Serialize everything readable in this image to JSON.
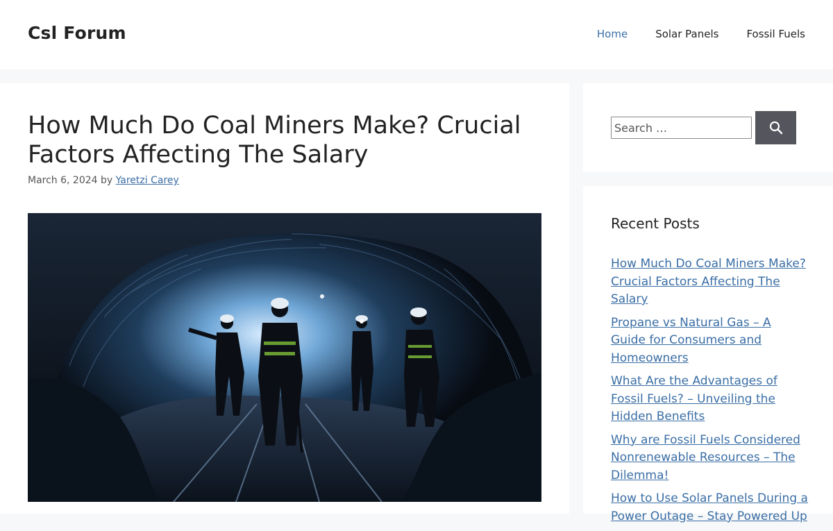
{
  "header": {
    "site_title": "Csl Forum",
    "nav": [
      {
        "label": "Home",
        "active": true
      },
      {
        "label": "Solar Panels",
        "active": false
      },
      {
        "label": "Fossil Fuels",
        "active": false
      }
    ]
  },
  "article": {
    "title": "How Much Do Coal Miners Make? Crucial Factors Affecting The Salary",
    "date": "March 6, 2024",
    "by": "by",
    "author": "Yaretzi Carey"
  },
  "sidebar": {
    "search": {
      "placeholder": "Search …",
      "button_icon": "search-icon"
    },
    "recent_posts": {
      "title": "Recent Posts",
      "items": [
        "How Much Do Coal Miners Make? Crucial Factors Affecting The Salary",
        "Propane vs Natural Gas – A Guide for Consumers and Homeowners",
        "What Are the Advantages of Fossil Fuels? – Unveiling the Hidden Benefits",
        "Why are Fossil Fuels Considered Nonrenewable Resources – The Dilemma!",
        "How to Use Solar Panels During a Power Outage – Stay Powered Up"
      ]
    }
  },
  "colors": {
    "link": "#3a6ea5",
    "page_bg": "#f7f8f9",
    "search_button": "#55555e"
  }
}
